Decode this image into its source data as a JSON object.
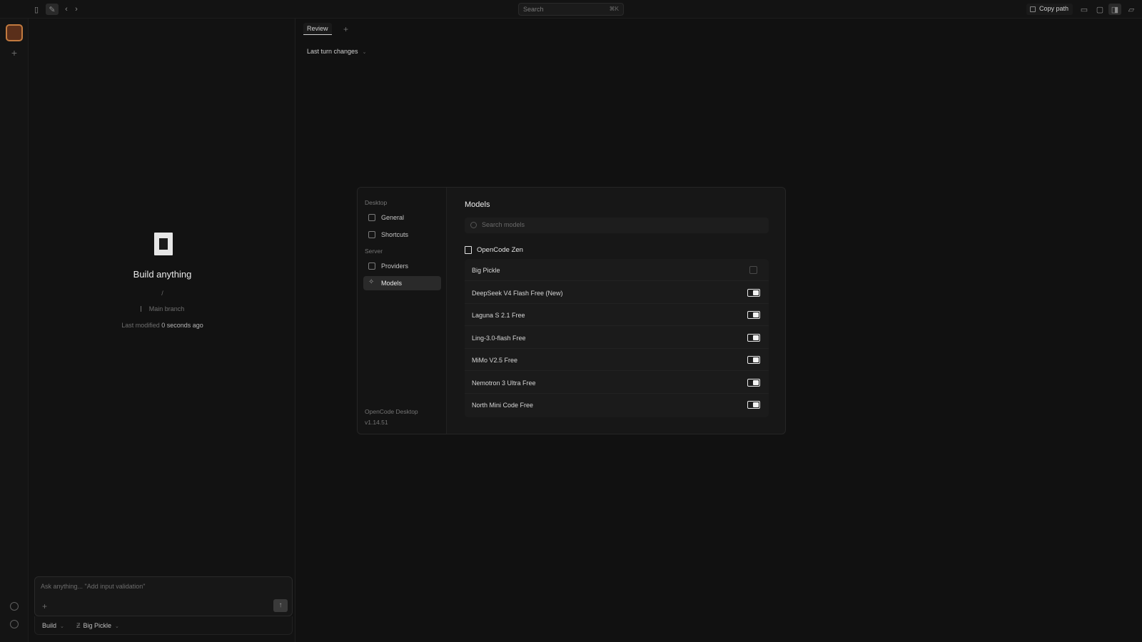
{
  "topbar": {
    "search_placeholder": "Search",
    "search_shortcut": "⌘K",
    "copy_path_label": "Copy path",
    "icons": [
      "sidebar-toggle-icon",
      "new-session-icon",
      "back-icon",
      "forward-icon",
      "terminal-icon",
      "file-icon",
      "panel-icon",
      "folder-icon"
    ]
  },
  "session": {
    "title": "Build anything",
    "path": "/",
    "branch": "Main branch",
    "last_modified_label": "Last modified",
    "last_modified_value": "0 seconds ago",
    "composer_placeholder": "Ask anything... \"Add input validation\"",
    "agent_label": "Build",
    "model_label": "Big Pickle"
  },
  "review": {
    "tab_label": "Review",
    "filter_label": "Last turn changes"
  },
  "settings": {
    "section_desktop": "Desktop",
    "section_server": "Server",
    "nav": {
      "general": "General",
      "shortcuts": "Shortcuts",
      "providers": "Providers",
      "models": "Models"
    },
    "app_name": "OpenCode Desktop",
    "app_version": "v1.14.51",
    "models_title": "Models",
    "search_placeholder": "Search models",
    "provider_name": "OpenCode Zen",
    "models": [
      {
        "name": "Big Pickle",
        "enabled": false
      },
      {
        "name": "DeepSeek V4 Flash Free (New)",
        "enabled": true
      },
      {
        "name": "Laguna S 2.1 Free",
        "enabled": true
      },
      {
        "name": "Ling-3.0-flash Free",
        "enabled": true
      },
      {
        "name": "MiMo V2.5 Free",
        "enabled": true
      },
      {
        "name": "Nemotron 3 Ultra Free",
        "enabled": true
      },
      {
        "name": "North Mini Code Free",
        "enabled": true
      }
    ]
  },
  "colors": {
    "background": "#111111",
    "avatar_accent": "#c27a3f",
    "toggle_on": "#f2f2f2"
  }
}
